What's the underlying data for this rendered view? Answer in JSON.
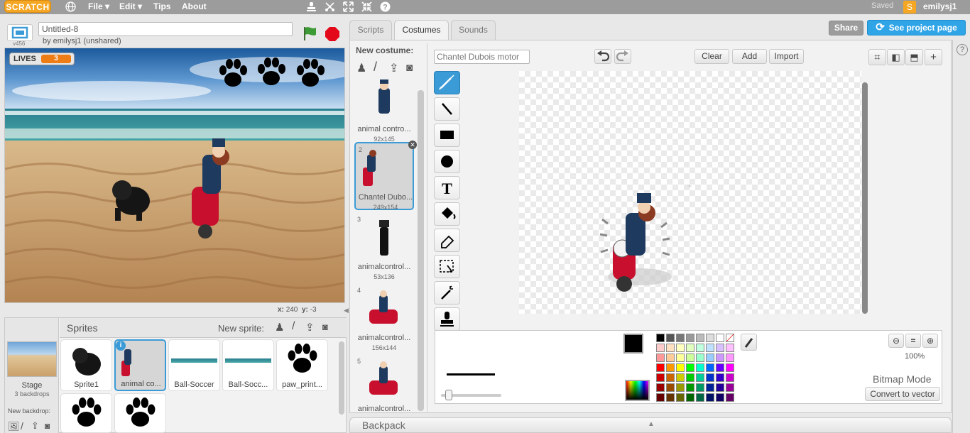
{
  "menubar": {
    "logo": "SCRATCH",
    "file": "File ▾",
    "edit": "Edit ▾",
    "tips": "Tips",
    "about": "About",
    "saved": "Saved",
    "username": "emilysj1"
  },
  "stage": {
    "version": "v456",
    "project_title": "Untitled-8",
    "byline": "by emilysj1 (unshared)",
    "lives_label": "LIVES",
    "lives_value": "3",
    "x_label": "x:",
    "x_value": "240",
    "y_label": "y:",
    "y_value": "-3"
  },
  "tabs": {
    "scripts": "Scripts",
    "costumes": "Costumes",
    "sounds": "Sounds"
  },
  "top_buttons": {
    "share": "Share",
    "see_project": "See project page"
  },
  "costume_pane": {
    "new_costume": "New costume:"
  },
  "costumes": [
    {
      "num": "1",
      "name": "animal contro...",
      "size": "92x145"
    },
    {
      "num": "2",
      "name": "Chantel Dubo...",
      "size": "249x154"
    },
    {
      "num": "3",
      "name": "animalcontrol...",
      "size": "53x136"
    },
    {
      "num": "4",
      "name": "animalcontrol...",
      "size": "156x144"
    },
    {
      "num": "5",
      "name": "animalcontrol...",
      "size": ""
    }
  ],
  "editor": {
    "costume_name": "Chantel Dubois motor",
    "clear": "Clear",
    "add": "Add",
    "import": "Import",
    "zoom": "100%",
    "mode": "Bitmap Mode",
    "convert": "Convert to vector"
  },
  "sprites_pane": {
    "title": "Sprites",
    "new_sprite": "New sprite:",
    "stage_label": "Stage",
    "backdrops": "3 backdrops",
    "new_backdrop": "New backdrop:"
  },
  "sprites": [
    {
      "name": "Sprite1"
    },
    {
      "name": "animal co..."
    },
    {
      "name": "Ball-Soccer"
    },
    {
      "name": "Ball-Socc..."
    },
    {
      "name": "paw_print..."
    }
  ],
  "backpack": {
    "label": "Backpack"
  },
  "colors": {
    "accent": "#3b9bd6",
    "menubar": "#9c9c9c",
    "flag": "#3d9b35",
    "stop": "#e4081b"
  }
}
